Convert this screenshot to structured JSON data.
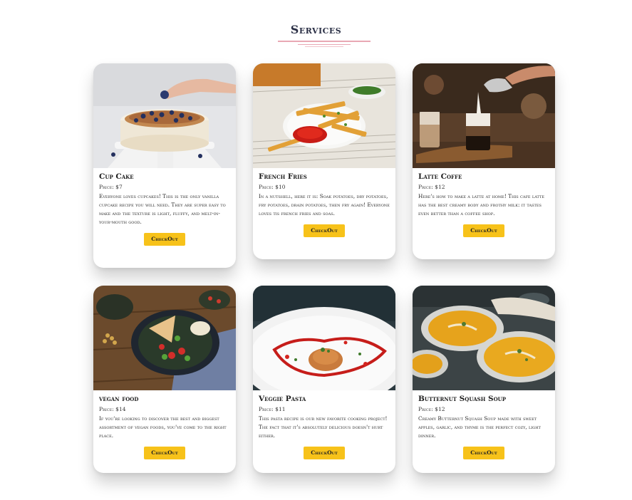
{
  "section": {
    "title": "Services"
  },
  "cards": [
    {
      "title": "Cup Cake",
      "price": "Price: $7",
      "description": "Everyone loves cupcakes! This is the only vanilla cupcake recipe you will need. They are super easy to make and the texture is light, fluffy, and melt-in-your-mouth good.",
      "button": "CheckOut"
    },
    {
      "title": "French Fries",
      "price": "Price: $10",
      "description": "In a nutshell, here it is: Soak potatoes, dry potatoes, fry potatoes, drain potatoes, then fry again! Everyone loves tis french fries and soas.",
      "button": "CheckOut"
    },
    {
      "title": "Latte Coffe",
      "price": "Price: $12",
      "description": "Here's how to make a latte at home! This cafe latte has the best creamy body and frothy milk: it tastes even better than a coffee shop.",
      "button": "CheckOut"
    },
    {
      "title": "vegan food",
      "price": "Price: $14",
      "description": "If you're looking to discover the best and biggest assortment of vegan foods, you've come to the right place.",
      "button": "CheckOut"
    },
    {
      "title": "Veggie Pasta",
      "price": "Price: $11",
      "description": "This pasta recipe is our new favorite cooking project! The fact that it's absolutely delicious doesn't hurt either.",
      "button": "CheckOut"
    },
    {
      "title": "Butternut Squash Soup",
      "price": "Price: $12",
      "description": "Creamy Butternut Squash Soup made with sweet apples, garlic, and thyme is the perfect cozy, light dinner.",
      "button": "CheckOut"
    }
  ],
  "colors": {
    "accent_button": "#f7c21a",
    "title_underline": "#e9a8b4",
    "title_text": "#2a2f45"
  }
}
